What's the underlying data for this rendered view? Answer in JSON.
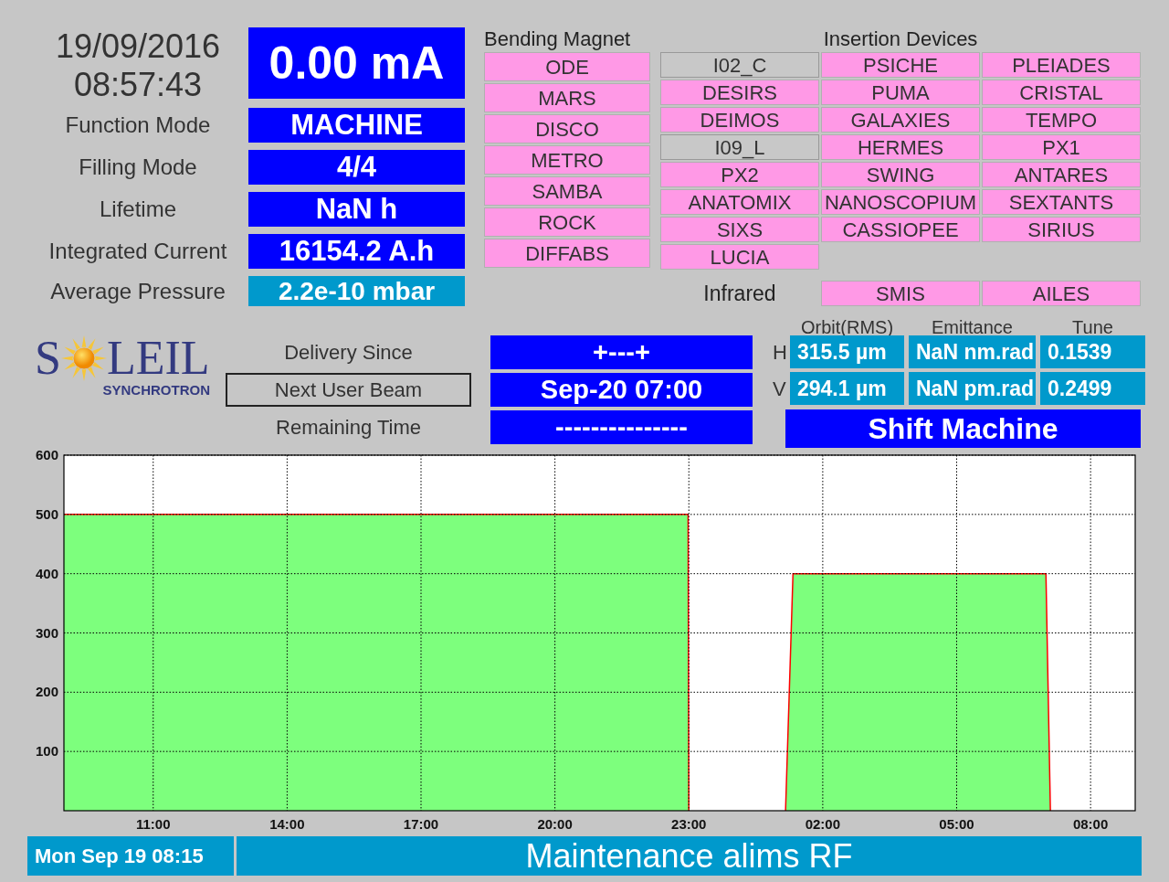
{
  "clock": {
    "date": "19/09/2016",
    "time": "08:57:43"
  },
  "beam_current": "0.00 mA",
  "parameters": [
    {
      "label": "Function Mode",
      "value": "MACHINE",
      "kind": "primary"
    },
    {
      "label": "Filling Mode",
      "value": "4/4",
      "kind": "primary"
    },
    {
      "label": "Lifetime",
      "value": "NaN h",
      "kind": "primary"
    },
    {
      "label": "Integrated Current",
      "value": "16154.2 A.h",
      "kind": "primary"
    },
    {
      "label": "Average Pressure",
      "value": "2.2e-10 mbar",
      "kind": "secondary"
    }
  ],
  "bending_magnet": {
    "title": "Bending Magnet",
    "beamlines": [
      {
        "name": "ODE",
        "active": true
      },
      {
        "name": "MARS",
        "active": true
      },
      {
        "name": "DISCO",
        "active": true
      },
      {
        "name": "METRO",
        "active": true
      },
      {
        "name": "SAMBA",
        "active": true
      },
      {
        "name": "ROCK",
        "active": true
      },
      {
        "name": "DIFFABS",
        "active": true
      }
    ]
  },
  "insertion_devices": {
    "title": "Insertion Devices",
    "beamlines": [
      {
        "name": "I02_C",
        "active": false
      },
      {
        "name": "PSICHE",
        "active": true
      },
      {
        "name": "PLEIADES",
        "active": true
      },
      {
        "name": "DESIRS",
        "active": true
      },
      {
        "name": "PUMA",
        "active": true
      },
      {
        "name": "CRISTAL",
        "active": true
      },
      {
        "name": "DEIMOS",
        "active": true
      },
      {
        "name": "GALAXIES",
        "active": true
      },
      {
        "name": "TEMPO",
        "active": true
      },
      {
        "name": "I09_L",
        "active": false
      },
      {
        "name": "HERMES",
        "active": true
      },
      {
        "name": "PX1",
        "active": true
      },
      {
        "name": "PX2",
        "active": true
      },
      {
        "name": "SWING",
        "active": true
      },
      {
        "name": "ANTARES",
        "active": true
      },
      {
        "name": "ANATOMIX",
        "active": true
      },
      {
        "name": "NANOSCOPIUM",
        "active": true
      },
      {
        "name": "SEXTANTS",
        "active": true
      },
      {
        "name": "SIXS",
        "active": true
      },
      {
        "name": "CASSIOPEE",
        "active": true
      },
      {
        "name": "SIRIUS",
        "active": true
      },
      {
        "name": "LUCIA",
        "active": true
      }
    ]
  },
  "infrared": {
    "title": "Infrared",
    "beamlines": [
      {
        "name": "SMIS",
        "active": true
      },
      {
        "name": "AILES",
        "active": true
      }
    ]
  },
  "logo": {
    "name_start": "S",
    "name_end": "LEIL",
    "subtitle": "SYNCHROTRON"
  },
  "schedule": [
    {
      "label": "Delivery Since",
      "value": "+---+",
      "highlighted": false
    },
    {
      "label": "Next User Beam",
      "value": "Sep-20 07:00",
      "highlighted": true
    },
    {
      "label": "Remaining Time",
      "value": "---------------",
      "highlighted": false
    }
  ],
  "beam_quality": {
    "columns": [
      "Orbit(RMS)",
      "Emittance",
      "Tune"
    ],
    "rows": [
      {
        "plane": "H",
        "values": [
          "315.5 µm",
          "NaN nm.rad",
          "0.1539"
        ]
      },
      {
        "plane": "V",
        "values": [
          "294.1 µm",
          "NaN pm.rad",
          "0.2499"
        ]
      }
    ]
  },
  "shift": "Shift Machine",
  "chart": {
    "chart_data": {
      "type": "area",
      "grid": true,
      "x": [
        "2016-09-19T09:00",
        "2016-09-19T22:59",
        "2016-09-19T23:00",
        "2016-09-19T23:30",
        "2016-09-20T01:10",
        "2016-09-20T01:20",
        "2016-09-20T07:00",
        "2016-09-20T07:06"
      ],
      "series": [
        {
          "color": "#7dff7d",
          "values": [
            500,
            500,
            0,
            null,
            0,
            400,
            400,
            0
          ]
        }
      ],
      "xlim": [
        "2016-09-19T09:00",
        "2016-09-20T09:00"
      ],
      "ylim": [
        0,
        600
      ],
      "xticks": [
        {
          "value": "2016-09-19T11:00",
          "label": "11:00"
        },
        {
          "value": "2016-09-19T14:00",
          "label": "14:00"
        },
        {
          "value": "2016-09-19T17:00",
          "label": "17:00"
        },
        {
          "value": "2016-09-19T20:00",
          "label": "20:00"
        },
        {
          "value": "2016-09-19T23:00",
          "label": "23:00"
        },
        {
          "value": "2016-09-20T02:00",
          "label": "02:00"
        },
        {
          "value": "2016-09-20T05:00",
          "label": "05:00"
        },
        {
          "value": "2016-09-20T08:00",
          "label": "08:00"
        }
      ],
      "yticks": [
        100,
        200,
        300,
        400,
        500,
        600
      ]
    }
  },
  "status_bar": {
    "date": "Mon Sep 19 08:15",
    "message": "Maintenance alims RF"
  }
}
